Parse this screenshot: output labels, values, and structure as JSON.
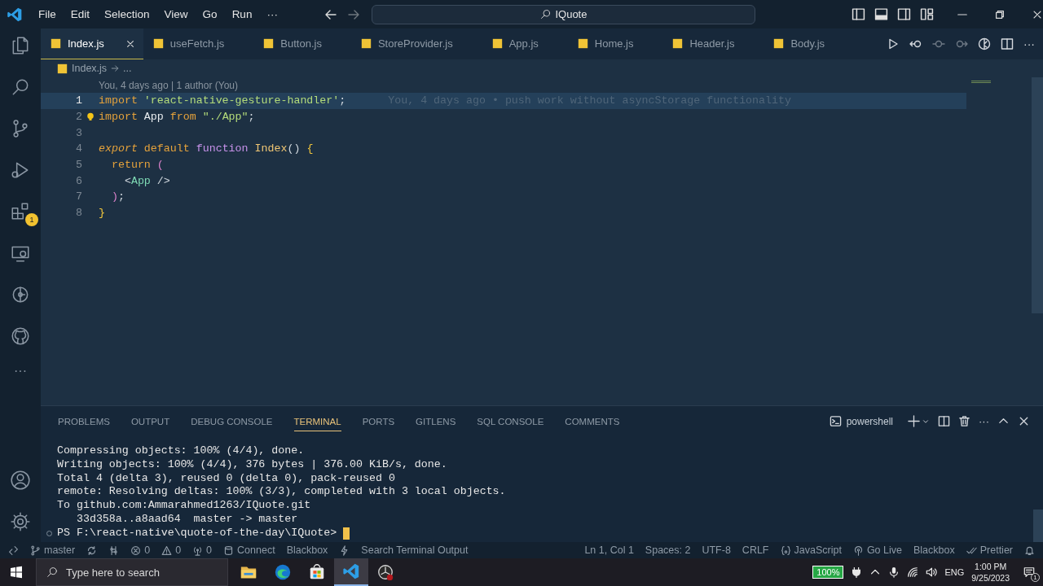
{
  "menu": [
    "File",
    "Edit",
    "Selection",
    "View",
    "Go",
    "Run",
    "···"
  ],
  "command_center": {
    "value": "IQuote"
  },
  "activity_bar": {
    "items": [
      {
        "kind": "files",
        "selected": false
      },
      {
        "kind": "search",
        "selected": false
      },
      {
        "kind": "source-control",
        "selected": false
      },
      {
        "kind": "run-debug",
        "selected": false
      },
      {
        "kind": "extensions",
        "selected": false,
        "badge": "1"
      },
      {
        "kind": "remote",
        "selected": false
      },
      {
        "kind": "timeline",
        "selected": false
      },
      {
        "kind": "github",
        "selected": false
      }
    ],
    "more": "···"
  },
  "tabs": [
    {
      "label": "Index.js",
      "selected": true
    },
    {
      "label": "useFetch.js",
      "selected": false
    },
    {
      "label": "Button.js",
      "selected": false
    },
    {
      "label": "StoreProvider.js",
      "selected": false
    },
    {
      "label": "App.js",
      "selected": false
    },
    {
      "label": "Home.js",
      "selected": false
    },
    {
      "label": "Header.js",
      "selected": false
    },
    {
      "label": "Body.js",
      "selected": false
    }
  ],
  "breadcrumb": [
    "Index.js",
    "..."
  ],
  "blame_header": "You, 4 days ago | 1 author (You)",
  "code_lines": [
    {
      "number": "1",
      "highlighted": true,
      "annotation": "You, 4 days ago • push work without asyncStorage functionality",
      "tokens": [
        {
          "text": "import",
          "kind": "kw"
        },
        {
          "text": " 'react-native-gesture-handler'",
          "kind": "str"
        },
        {
          "text": ";",
          "kind": "punct"
        }
      ]
    },
    {
      "number": "2",
      "highlighted": false,
      "lightbulb": true,
      "tokens": [
        {
          "text": "import",
          "kind": "kw"
        },
        {
          "text": " App ",
          "kind": "plain"
        },
        {
          "text": "from",
          "kind": "kw"
        },
        {
          "text": " \"./App\"",
          "kind": "str"
        },
        {
          "text": ";",
          "kind": "punct"
        }
      ]
    },
    {
      "number": "3",
      "highlighted": false
    },
    {
      "number": "4",
      "highlighted": false,
      "tokens": [
        {
          "text": "export",
          "kind": "kw-italic"
        },
        {
          "text": " default ",
          "kind": "kw"
        },
        {
          "text": "function",
          "kind": "fn"
        },
        {
          "text": " Index",
          "kind": "name"
        },
        {
          "text": "() ",
          "kind": "punct"
        },
        {
          "text": "{",
          "kind": "brace"
        }
      ]
    },
    {
      "number": "5",
      "highlighted": false,
      "tokens": [
        {
          "text": "  return ",
          "kind": "kw"
        },
        {
          "text": "(",
          "kind": "paren"
        }
      ]
    },
    {
      "number": "6",
      "highlighted": false,
      "tokens": [
        {
          "text": "    <",
          "kind": "punct"
        },
        {
          "text": "App",
          "kind": "tag"
        },
        {
          "text": " />",
          "kind": "punct"
        }
      ]
    },
    {
      "number": "7",
      "highlighted": false,
      "tokens": [
        {
          "text": "  )",
          "kind": "paren"
        },
        {
          "text": ";",
          "kind": "punct"
        }
      ]
    },
    {
      "number": "8",
      "highlighted": false,
      "tokens": [
        {
          "text": "}",
          "kind": "brace"
        }
      ]
    }
  ],
  "panel": {
    "tabs": [
      {
        "label": "PROBLEMS",
        "selected": false
      },
      {
        "label": "OUTPUT",
        "selected": false
      },
      {
        "label": "DEBUG CONSOLE",
        "selected": false
      },
      {
        "label": "TERMINAL",
        "selected": true
      },
      {
        "label": "PORTS",
        "selected": false
      },
      {
        "label": "GITLENS",
        "selected": false
      },
      {
        "label": "SQL CONSOLE",
        "selected": false
      },
      {
        "label": "COMMENTS",
        "selected": false
      }
    ],
    "shell": "powershell",
    "terminal_lines": [
      "Compressing objects: 100% (4/4), done.",
      "Writing objects: 100% (4/4), 376 bytes | 376.00 KiB/s, done.",
      "Total 4 (delta 3), reused 0 (delta 0), pack-reused 0",
      "remote: Resolving deltas: 100% (3/3), completed with 3 local objects.",
      "To github.com:Ammarahmed1263/IQuote.git",
      "   33d358a..a8aad64  master -> master"
    ],
    "prompt": "PS F:\\react-native\\quote-of-the-day\\IQuote>"
  },
  "status_bar": {
    "left": [
      {
        "kind": "remote"
      },
      {
        "kind": "branch",
        "text": "master"
      },
      {
        "kind": "sync"
      },
      {
        "kind": "graph"
      },
      {
        "kind": "error",
        "text": "0"
      },
      {
        "kind": "warning",
        "text": "0"
      },
      {
        "kind": "ports",
        "text": "0"
      },
      {
        "kind": "database",
        "text": "Connect"
      },
      {
        "kind": "text",
        "text": "Blackbox"
      },
      {
        "kind": "bolt"
      },
      {
        "kind": "text",
        "text": "Search Terminal Output"
      }
    ],
    "right": [
      {
        "kind": "text",
        "text": "Ln 1, Col 1"
      },
      {
        "kind": "text",
        "text": "Spaces: 2"
      },
      {
        "kind": "text",
        "text": "UTF-8"
      },
      {
        "kind": "text",
        "text": "CRLF"
      },
      {
        "kind": "braces",
        "text": "JavaScript"
      },
      {
        "kind": "broadcast",
        "text": "Go Live"
      },
      {
        "kind": "text",
        "text": "Blackbox"
      },
      {
        "kind": "checks",
        "text": "Prettier"
      },
      {
        "kind": "bell"
      }
    ]
  },
  "taskbar": {
    "search": {
      "placeholder": "Type here to search"
    },
    "apps": [
      {
        "kind": "folder",
        "selected": false
      },
      {
        "kind": "edge",
        "selected": false
      },
      {
        "kind": "store",
        "selected": false
      },
      {
        "kind": "vscode",
        "selected": true
      },
      {
        "kind": "recorder",
        "selected": false
      }
    ],
    "battery": "100%",
    "language": "ENG",
    "time": "1:00 PM",
    "date": "9/25/2023",
    "notifications": "1"
  }
}
